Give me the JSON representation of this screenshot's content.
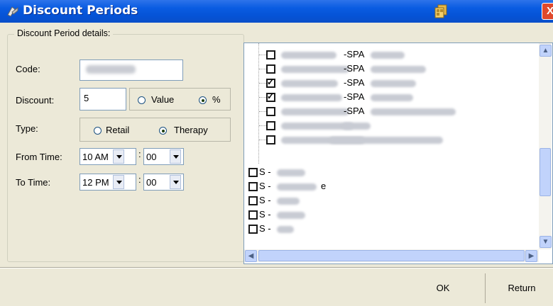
{
  "window": {
    "title": "Discount Periods",
    "close_label": "X"
  },
  "group": {
    "title": "Discount Period details:"
  },
  "form": {
    "code_label": "Code:",
    "discount_label": "Discount:",
    "discount_value": "5",
    "discount_mode": {
      "value_label": "Value",
      "percent_label": "%",
      "selected": "percent"
    },
    "type_label": "Type:",
    "type": {
      "retail_label": "Retail",
      "therapy_label": "Therapy",
      "selected": "therapy"
    },
    "from_time_label": "From Time:",
    "from_hour": "10 AM",
    "from_minute": "00",
    "to_time_label": "To Time:",
    "to_hour": "12 PM",
    "to_minute": "00",
    "time_colon": ":"
  },
  "tree": {
    "children": [
      {
        "suffix": "-SPA",
        "checked": false
      },
      {
        "suffix": "-SPA",
        "checked": false
      },
      {
        "suffix": "-SPA",
        "checked": true
      },
      {
        "suffix": "-SPA",
        "checked": true
      },
      {
        "suffix": "-SPA",
        "checked": false
      },
      {
        "suffix": "",
        "checked": false
      },
      {
        "suffix": "",
        "checked": false
      }
    ],
    "roots": [
      {
        "prefix": "S -",
        "tail": "",
        "checked": false
      },
      {
        "prefix": "S -",
        "tail": "e",
        "checked": false
      },
      {
        "prefix": "S -",
        "tail": "",
        "checked": false
      },
      {
        "prefix": "S -",
        "tail": "",
        "checked": false
      },
      {
        "prefix": "S -",
        "tail": "",
        "checked": false
      }
    ]
  },
  "buttons": {
    "ok": "OK",
    "return": "Return"
  },
  "colors": {
    "titlebar": "#0553d6",
    "dialog_bg": "#ece9d8",
    "close": "#e0492c"
  }
}
